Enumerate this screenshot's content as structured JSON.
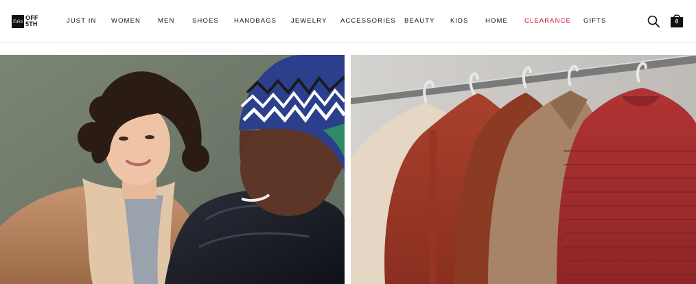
{
  "brand": {
    "logo_mark": "Saks",
    "logo_text": "OFF 5TH"
  },
  "nav": {
    "items": [
      {
        "label": "JUST IN"
      },
      {
        "label": "WOMEN"
      },
      {
        "label": "MEN"
      },
      {
        "label": "SHOES"
      },
      {
        "label": "HANDBAGS"
      },
      {
        "label": "JEWELRY"
      },
      {
        "label": "ACCESSORIES"
      },
      {
        "label": "BEAUTY"
      },
      {
        "label": "KIDS"
      },
      {
        "label": "HOME"
      },
      {
        "label": "CLEARANCE"
      },
      {
        "label": "GIFTS"
      }
    ]
  },
  "header": {
    "search_icon": "search-icon",
    "bag_icon": "shopping-bag-icon",
    "bag_count": "0"
  },
  "colors": {
    "accent_sale": "#c8102e",
    "text": "#111111"
  },
  "hero": {
    "left_image": "couple-in-winter-coats",
    "right_image": "sweaters-on-rack"
  }
}
